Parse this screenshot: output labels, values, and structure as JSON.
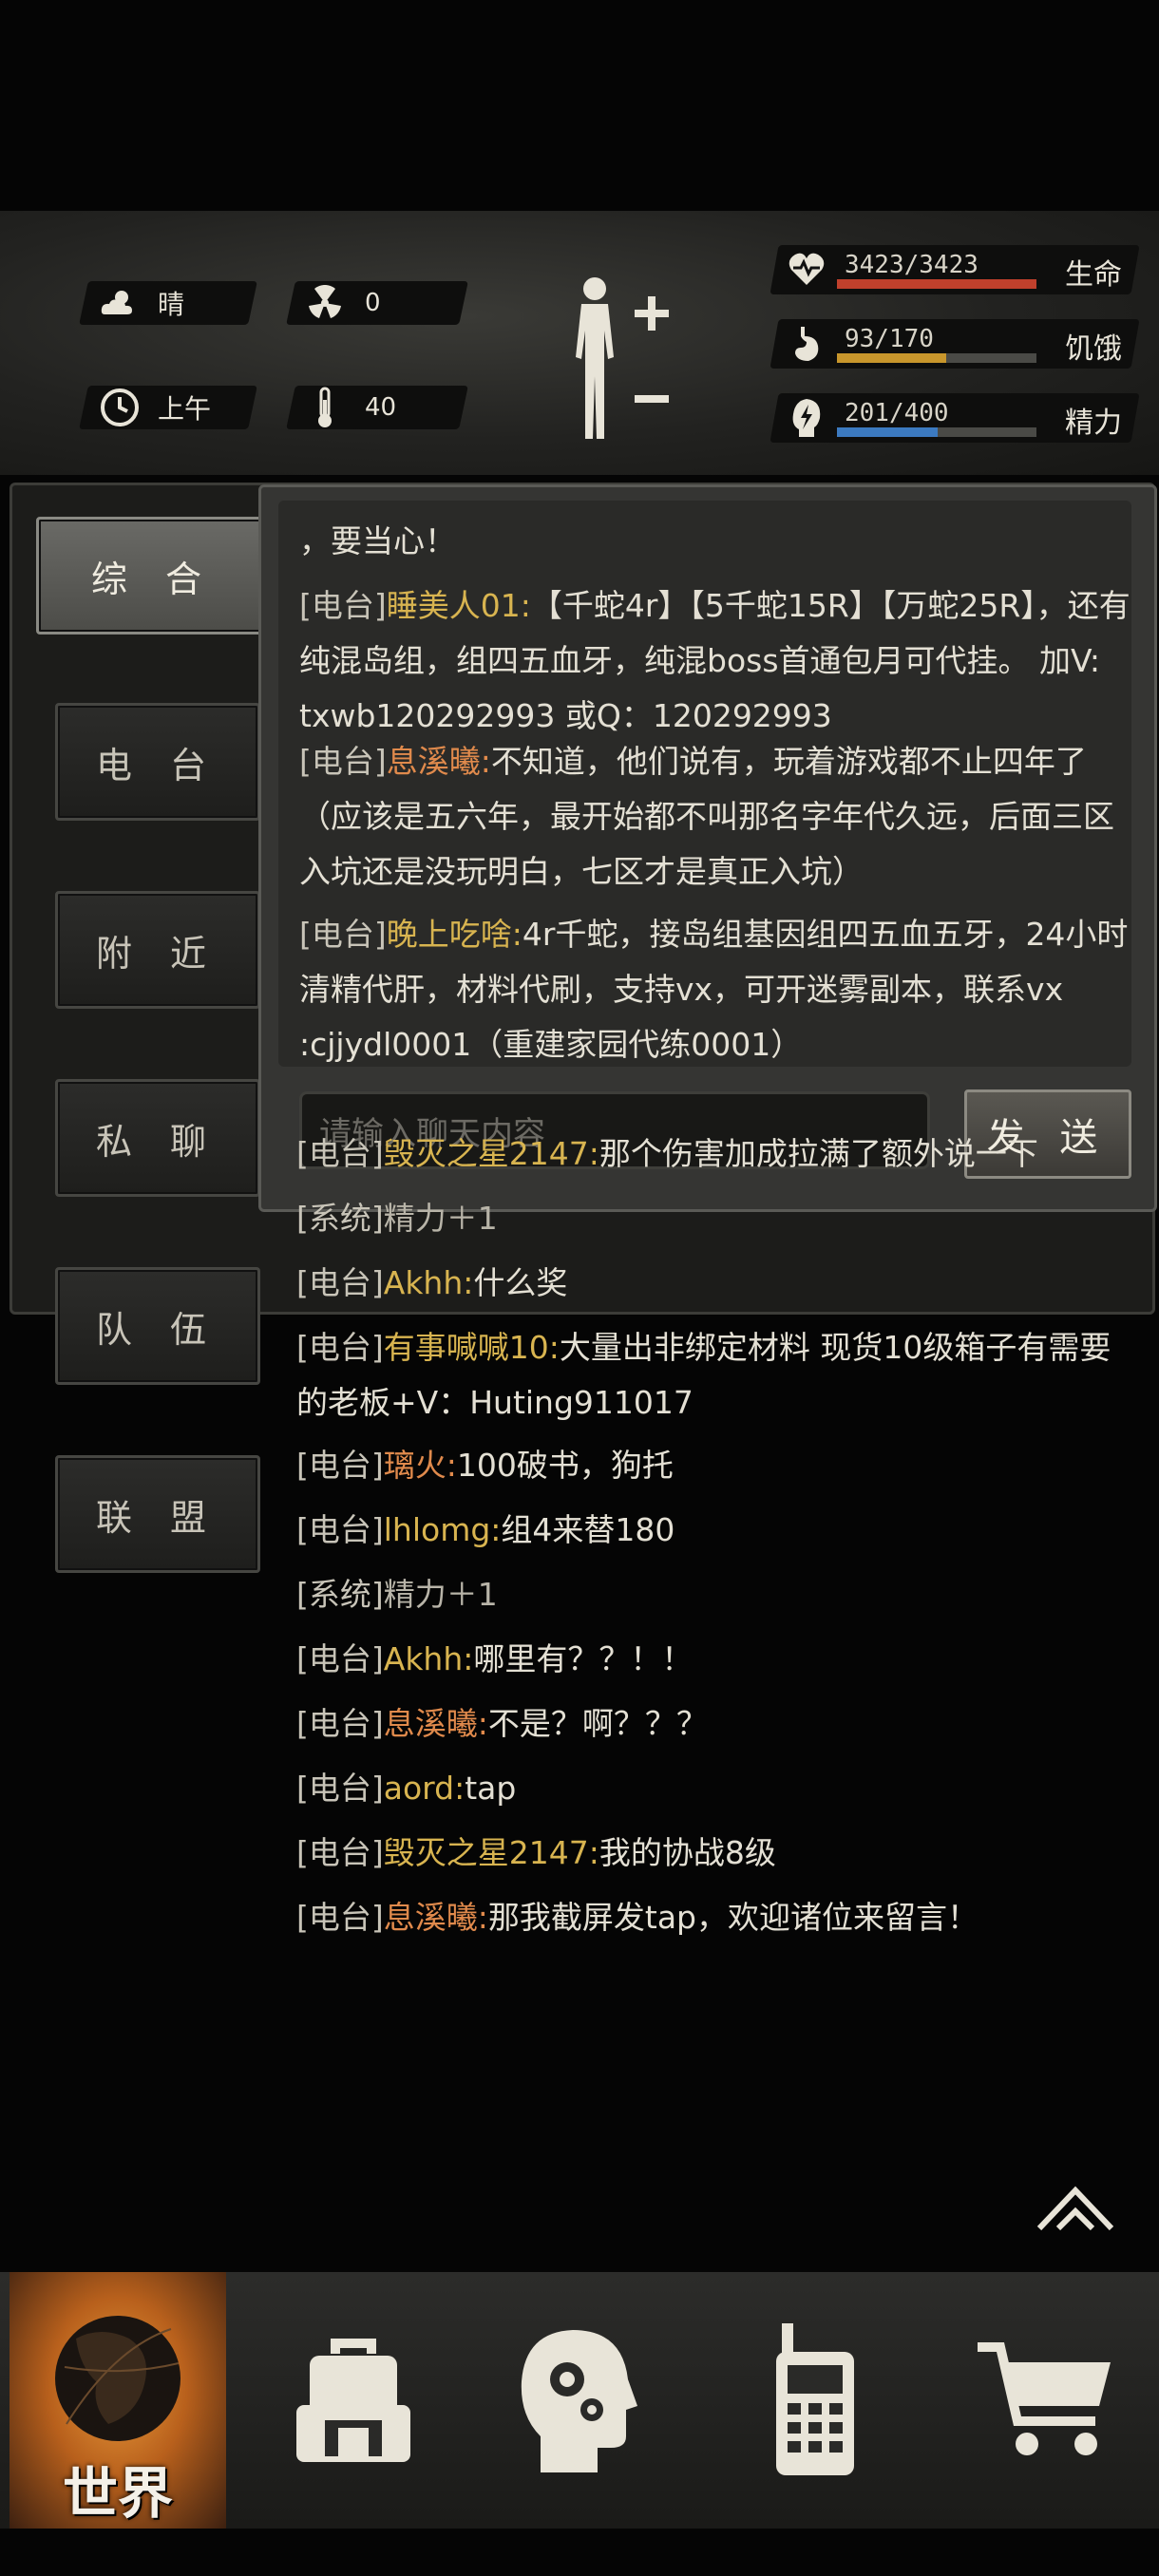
{
  "status": {
    "weather": "晴",
    "radiation": "0",
    "time_of_day": "上午",
    "temperature": "40"
  },
  "vitals": [
    {
      "name": "生命",
      "value": "3423/3423",
      "ratio": 1.0,
      "color": "#c0402c"
    },
    {
      "name": "饥饿",
      "value": "93/170",
      "ratio": 0.547,
      "color": "#c8962c"
    },
    {
      "name": "精力",
      "value": "201/400",
      "ratio": 0.5025,
      "color": "#3c7ac0"
    }
  ],
  "tabs": [
    "综 合",
    "电 台",
    "附 近",
    "私 聊",
    "队 伍",
    "联 盟"
  ],
  "chat": {
    "partial_top": "，要当心！",
    "messages": [
      {
        "tag": "[电台]",
        "name": "睡美人01:",
        "name_color": "y",
        "text": "【千蛇4r】【5千蛇15R】【万蛇25R】，还有纯混岛组，组四五血牙，纯混boss首通包月可代挂。 加V: txwb120292993 或Q：120292993"
      },
      {
        "tag": "[电台]",
        "name": "息溪曦:",
        "name_color": "o",
        "text": "不知道，他们说有，玩着游戏都不止四年了（应该是五六年，最开始都不叫那名字年代久远，后面三区入坑还是没玩明白，七区才是真正入坑）"
      },
      {
        "tag": "[电台]",
        "name": "晚上吃啥:",
        "name_color": "y",
        "text": "4r千蛇，接岛组基因组四五血五牙，24小时清精代肝，材料代刷，支持vx，可开迷雾副本，联系vx :cjjydl0001（重建家园代练0001）"
      },
      {
        "tag": "[电台]",
        "name": "毁灭之星2147:",
        "name_color": "y",
        "text": "那个伤害加成拉满了额外说一下"
      },
      {
        "tag": "[系统]",
        "name": "",
        "name_color": "s",
        "text": "精力＋1"
      },
      {
        "tag": "[电台]",
        "name": "Akhh:",
        "name_color": "y",
        "text": "什么奖"
      },
      {
        "tag": "[电台]",
        "name": "有事喊喊10:",
        "name_color": "y",
        "text": "大量出非绑定材料 现货10级箱子有需要的老板+V：Huting911017"
      },
      {
        "tag": "[电台]",
        "name": "璃火:",
        "name_color": "o",
        "text": "100破书，狗托"
      },
      {
        "tag": "[电台]",
        "name": "lhlomg:",
        "name_color": "y",
        "text": "组4来替180"
      },
      {
        "tag": "[系统]",
        "name": "",
        "name_color": "s",
        "text": "精力＋1"
      },
      {
        "tag": "[电台]",
        "name": "Akhh:",
        "name_color": "y",
        "text": "哪里有？？！！"
      },
      {
        "tag": "[电台]",
        "name": "息溪曦:",
        "name_color": "o",
        "text": "不是？啊？？？"
      },
      {
        "tag": "[电台]",
        "name": "aord:",
        "name_color": "y",
        "text": "tap"
      },
      {
        "tag": "[电台]",
        "name": "毁灭之星2147:",
        "name_color": "y",
        "text": "我的协战8级"
      },
      {
        "tag": "[电台]",
        "name": "息溪曦:",
        "name_color": "o",
        "text": "那我截屏发tap，欢迎诸位来留言！"
      }
    ],
    "input_placeholder": "请输入聊天内容",
    "send_label": "发 送"
  },
  "nav": {
    "world_label": "世界",
    "items": [
      "backpack-icon",
      "skills-head-icon",
      "radio-icon",
      "shop-cart-icon"
    ]
  },
  "colors": {
    "name_yellow": "#d8b450",
    "name_orange": "#e08a4c"
  }
}
